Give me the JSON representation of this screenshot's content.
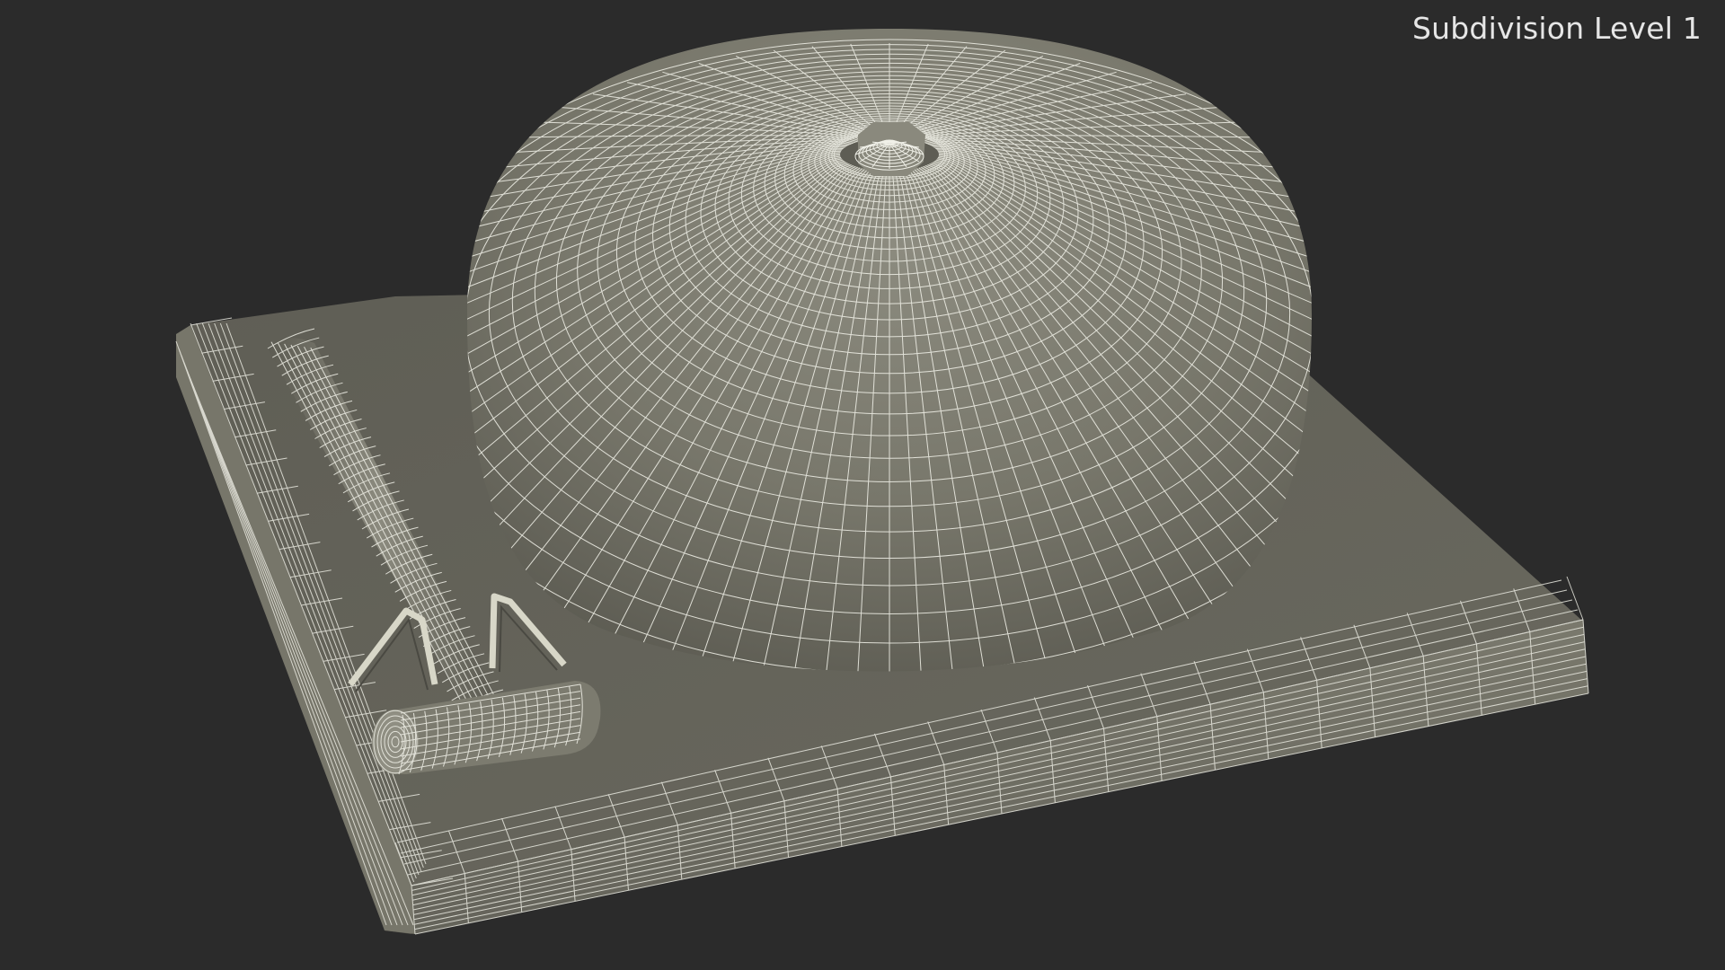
{
  "viewport": {
    "subdivision_label": "Subdivision Level 1"
  },
  "colors": {
    "background": "#2b2b2b",
    "surface": "#6f6e63",
    "surface_light": "#8a897d",
    "surface_dark": "#55544b",
    "wire": "#e9e9e0"
  },
  "objects": [
    {
      "name": "bell-dome",
      "kind": "wireframe"
    },
    {
      "name": "bolt",
      "kind": "wireframe"
    },
    {
      "name": "base-plate",
      "kind": "wireframe"
    },
    {
      "name": "hammer-handle",
      "kind": "wireframe"
    },
    {
      "name": "hammer-head",
      "kind": "wireframe"
    },
    {
      "name": "spring-clips",
      "kind": "wireframe"
    }
  ]
}
